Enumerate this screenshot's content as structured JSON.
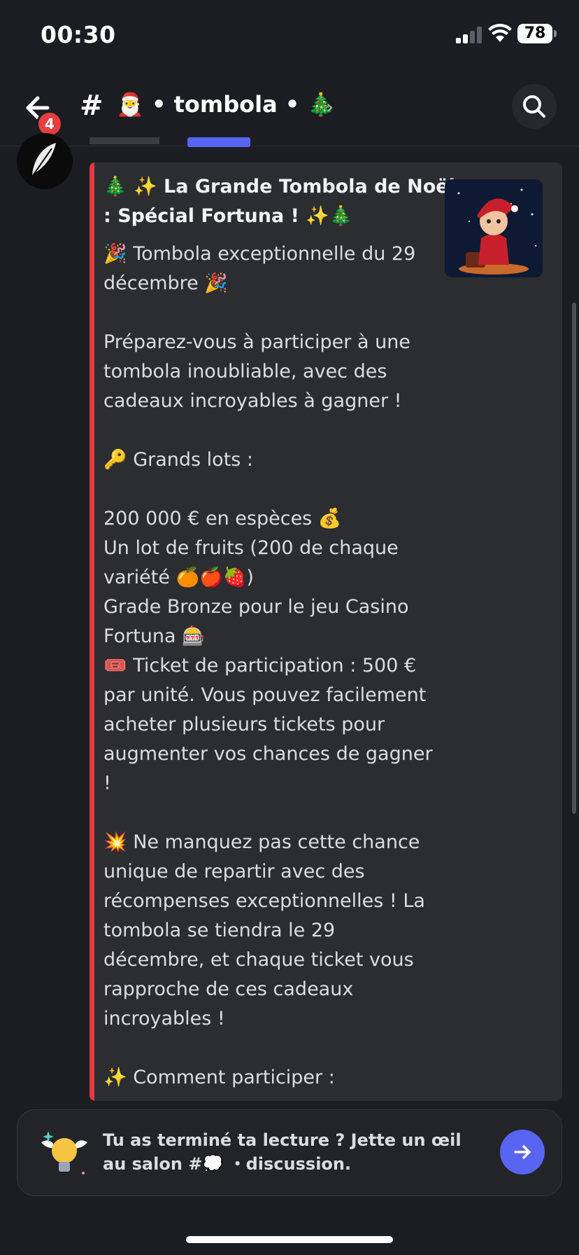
{
  "status_bar": {
    "time": "00:30",
    "battery": "78"
  },
  "header": {
    "notification_count": "4",
    "hash": "#",
    "channel_name": "🎅 • tombola • 🎄",
    "chevron": "›"
  },
  "embed": {
    "title": "🎄 ✨ La Grande Tombola de Noël\n: Spécial Fortuna ! ✨🎄",
    "body": "🎉 Tombola exceptionnelle du 29\ndécembre 🎉\n\nPréparez-vous à participer à une\ntombola inoubliable, avec des\ncadeaux incroyables à gagner !\n\n🔑 Grands lots :\n\n200 000 € en espèces 💰\nUn lot de fruits (200 de chaque\nvariété 🍊🍎🍓)\nGrade Bronze pour le jeu Casino\nFortuna 🎰\n🎟️ Ticket de participation : 500 €\npar unité. Vous pouvez facilement\nacheter plusieurs tickets pour\naugmenter vos chances de gagner\n!\n\n💥 Ne manquez pas cette chance\nunique de repartir avec des\nrécompenses exceptionnelles ! La\ntombola se tiendra le 29\ndécembre, et chaque ticket vous\nrapproche de ces cadeaux\nincroyables !\n\n✨ Comment participer :\n\n\n\nProcédez à l'achat de plusieurs",
    "accent_color": "#e5393f"
  },
  "promo": {
    "text": "Tu as terminé ta lecture ? Jette un œil au salon #💭 ・discussion."
  },
  "colors": {
    "background": "#1c1d22",
    "embed_bg": "#2b2d31",
    "blurple": "#5865f2",
    "badge": "#e53e3e"
  }
}
